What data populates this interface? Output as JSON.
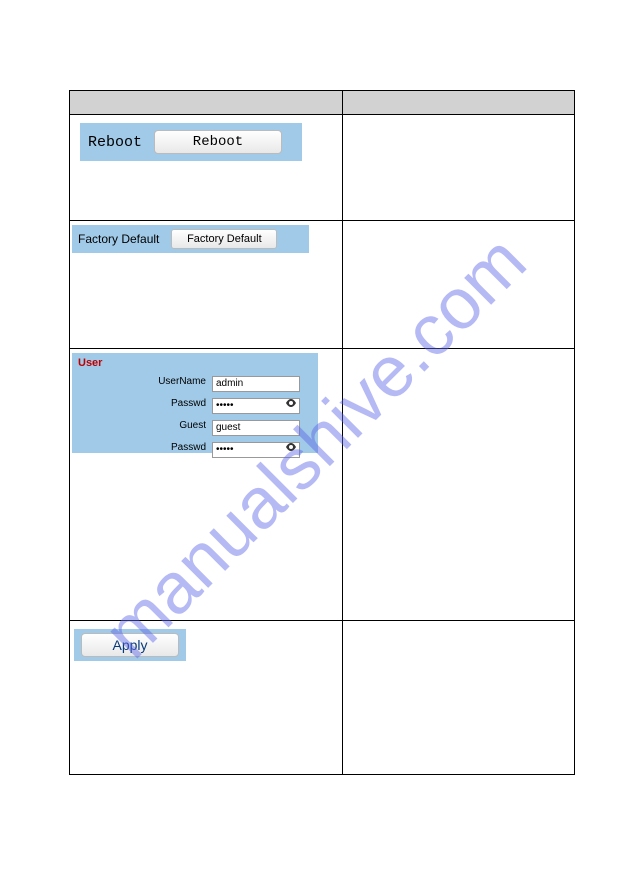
{
  "watermark": "manualshive.com",
  "reboot": {
    "label": "Reboot",
    "button": "Reboot"
  },
  "factory": {
    "label": "Factory Default",
    "button": "Factory Default"
  },
  "user": {
    "title": "User",
    "username_label": "UserName",
    "username_value": "admin",
    "passwd1_label": "Passwd",
    "passwd1_value": "•••••",
    "guest_label": "Guest",
    "guest_value": "guest",
    "passwd2_label": "Passwd",
    "passwd2_value": "•••••"
  },
  "apply": {
    "button": "Apply"
  }
}
